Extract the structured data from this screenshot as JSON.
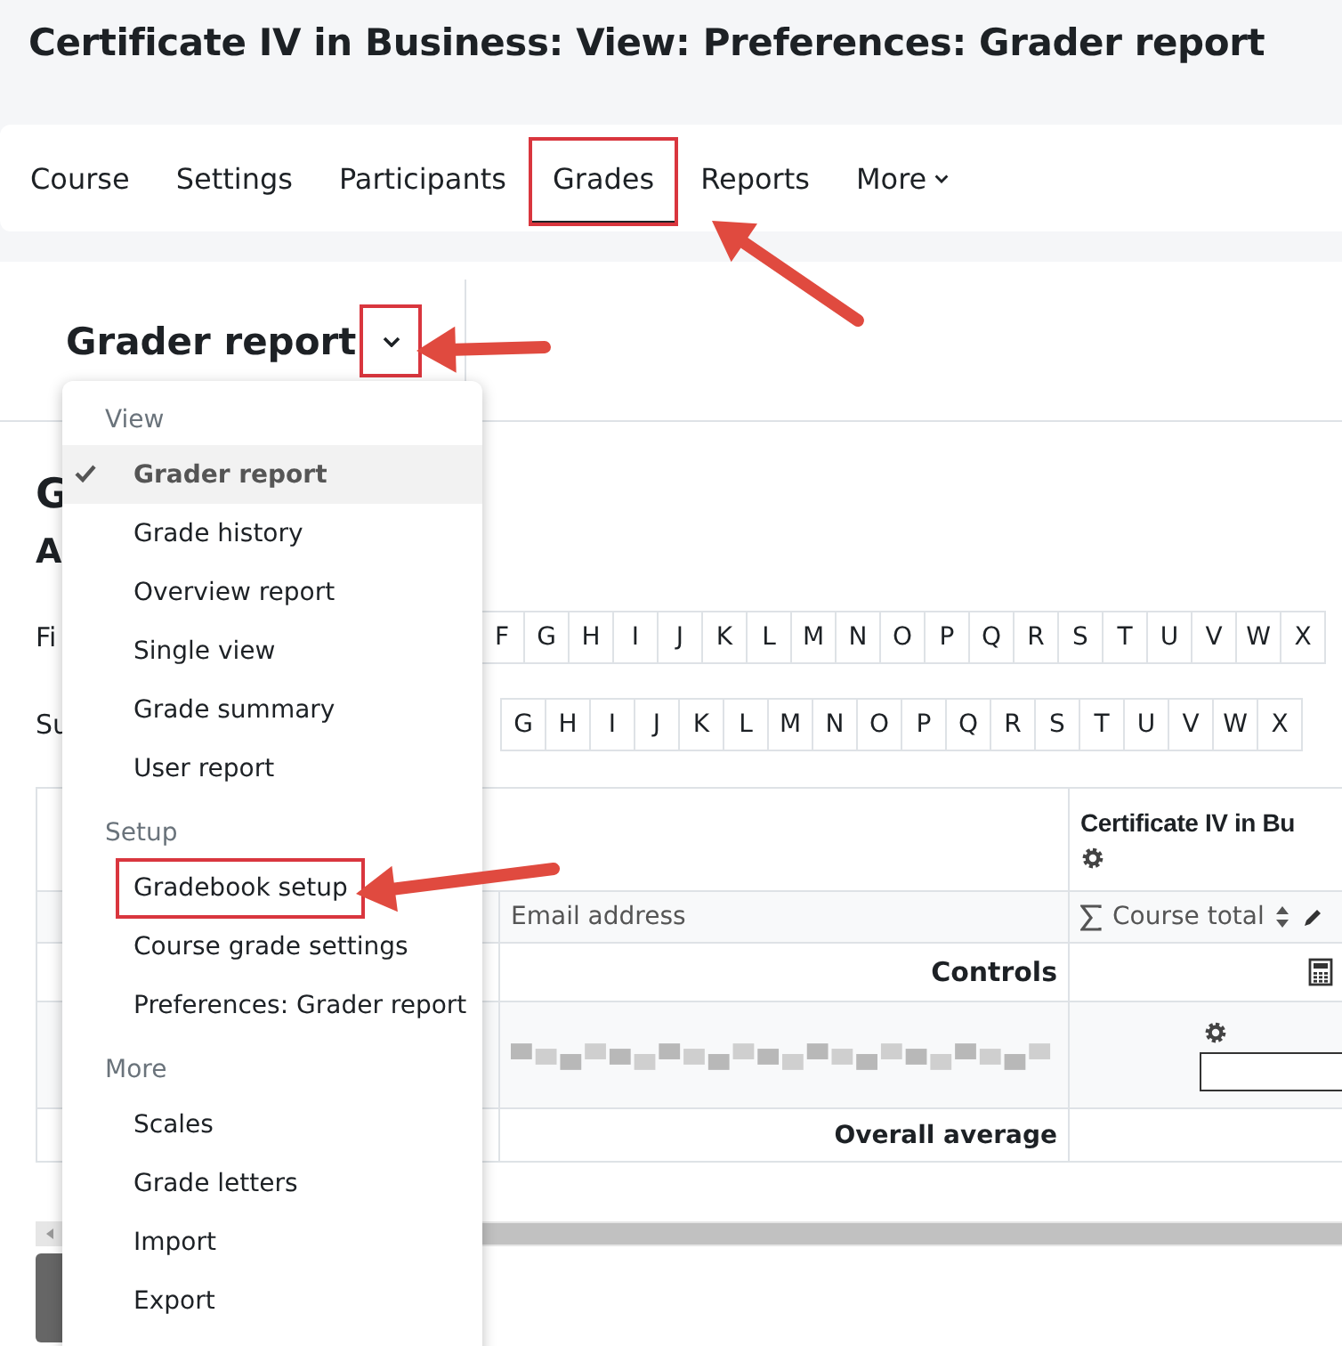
{
  "page_title": "Certificate IV in Business: View: Preferences: Grader report",
  "nav_tabs": [
    {
      "label": "Course",
      "selected": false,
      "highlighted": false,
      "kind": "link"
    },
    {
      "label": "Settings",
      "selected": false,
      "highlighted": false,
      "kind": "link"
    },
    {
      "label": "Participants",
      "selected": false,
      "highlighted": false,
      "kind": "link"
    },
    {
      "label": "Grades",
      "selected": true,
      "highlighted": true,
      "kind": "link"
    },
    {
      "label": "Reports",
      "selected": false,
      "highlighted": false,
      "kind": "link"
    },
    {
      "label": "More",
      "selected": false,
      "highlighted": false,
      "kind": "dropdown"
    }
  ],
  "report_selector": {
    "label": "Grader report",
    "expanded": true,
    "highlighted": true
  },
  "menu": {
    "sections": [
      {
        "heading": "View",
        "items": [
          {
            "label": "Grader report",
            "selected": true,
            "highlighted": false
          },
          {
            "label": "Grade history",
            "selected": false,
            "highlighted": false
          },
          {
            "label": "Overview report",
            "selected": false,
            "highlighted": false
          },
          {
            "label": "Single view",
            "selected": false,
            "highlighted": false
          },
          {
            "label": "Grade summary",
            "selected": false,
            "highlighted": false
          },
          {
            "label": "User report",
            "selected": false,
            "highlighted": false
          }
        ]
      },
      {
        "heading": "Setup",
        "items": [
          {
            "label": "Gradebook setup",
            "selected": false,
            "highlighted": true
          },
          {
            "label": "Course grade settings",
            "selected": false,
            "highlighted": false
          },
          {
            "label": "Preferences: Grader report",
            "selected": false,
            "highlighted": false
          }
        ]
      },
      {
        "heading": "More",
        "items": [
          {
            "label": "Scales",
            "selected": false,
            "highlighted": false
          },
          {
            "label": "Grade letters",
            "selected": false,
            "highlighted": false
          },
          {
            "label": "Import",
            "selected": false,
            "highlighted": false
          },
          {
            "label": "Export",
            "selected": false,
            "highlighted": false
          }
        ]
      }
    ]
  },
  "content": {
    "heading": "G",
    "subheading": "A",
    "filters": [
      {
        "label": "Fi",
        "letters": [
          "F",
          "G",
          "H",
          "I",
          "J",
          "K",
          "L",
          "M",
          "N",
          "O",
          "P",
          "Q",
          "R",
          "S",
          "T",
          "U",
          "V",
          "W",
          "X"
        ]
      },
      {
        "label": "Su",
        "letters": [
          "G",
          "H",
          "I",
          "J",
          "K",
          "L",
          "M",
          "N",
          "O",
          "P",
          "Q",
          "R",
          "S",
          "T",
          "U",
          "V",
          "W",
          "X"
        ]
      }
    ]
  },
  "table": {
    "course_header": "Certificate IV in Bu",
    "email_header": "Email address",
    "course_total": "Course total",
    "controls_label": "Controls",
    "overall_average_label": "Overall average"
  }
}
